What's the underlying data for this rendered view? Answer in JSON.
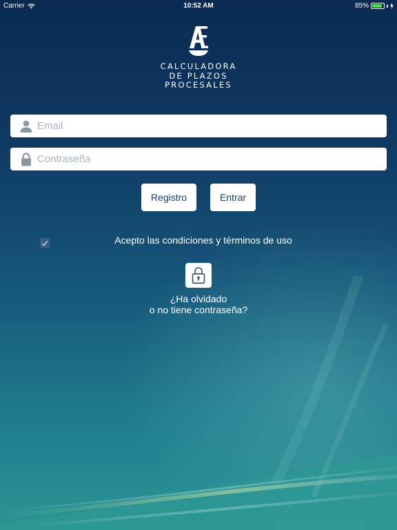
{
  "status_bar": {
    "carrier": "Carrier",
    "time": "10:52 AM",
    "battery": "85%",
    "battery_level": 0.85,
    "icons": [
      "wifi-icon",
      "battery-icon",
      "charging-bolt-icon"
    ]
  },
  "logo": {
    "mark": "A",
    "lines": [
      "CALCULADORA",
      "DE PLAZOS",
      "PROCESALES"
    ]
  },
  "form": {
    "email_placeholder": "Email",
    "email_value": "",
    "email_icon": "user-icon",
    "password_placeholder": "Contraseña",
    "password_value": "",
    "password_icon": "lock-icon"
  },
  "buttons": {
    "register": "Registro",
    "login": "Entrar"
  },
  "terms": {
    "label": "Acepto las condiciones y términos de uso",
    "checked": true
  },
  "forgot": {
    "icon": "padlock-icon",
    "line1": "¿Ha olvidado",
    "line2": "o no tiene contraseña?"
  },
  "colors": {
    "background_top": "#0a2a52",
    "background_bottom": "#2b9494",
    "button_text": "#1b3d66",
    "battery_fill": "#4cd964"
  }
}
